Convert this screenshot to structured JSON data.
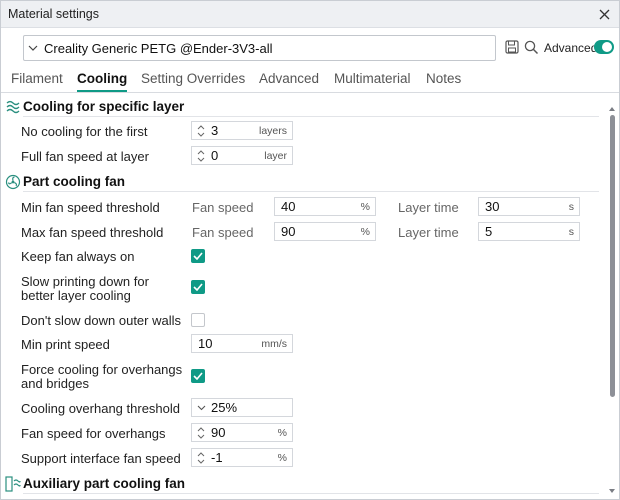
{
  "window": {
    "title": "Material settings"
  },
  "toolbar": {
    "preset": "Creality Generic PETG @Ender-3V3-all",
    "advanced_label": "Advanced",
    "advanced_on": true
  },
  "tabs": [
    {
      "label": "Filament",
      "active": false
    },
    {
      "label": "Cooling",
      "active": true
    },
    {
      "label": "Setting Overrides",
      "active": false
    },
    {
      "label": "Advanced",
      "active": false
    },
    {
      "label": "Multimaterial",
      "active": false
    },
    {
      "label": "Notes",
      "active": false
    }
  ],
  "sections": {
    "cooling_layer": {
      "title": "Cooling for specific layer",
      "rows": [
        {
          "label": "No cooling for the first",
          "value": "3",
          "unit": "layers"
        },
        {
          "label": "Full fan speed at layer",
          "value": "0",
          "unit": "layer"
        }
      ]
    },
    "part_cooling": {
      "title": "Part cooling fan",
      "min_fan": {
        "label": "Min fan speed threshold",
        "fan_label": "Fan speed",
        "fan_value": "40",
        "fan_unit": "%",
        "time_label": "Layer time",
        "time_value": "30",
        "time_unit": "s"
      },
      "max_fan": {
        "label": "Max fan speed threshold",
        "fan_label": "Fan speed",
        "fan_value": "90",
        "fan_unit": "%",
        "time_label": "Layer time",
        "time_value": "5",
        "time_unit": "s"
      },
      "keep_fan": {
        "label": "Keep fan always on",
        "checked": true
      },
      "slow_down": {
        "label_line1": "Slow printing down for",
        "label_line2": "better layer cooling",
        "checked": true
      },
      "dont_slow": {
        "label": "Don't slow down outer walls",
        "checked": false
      },
      "min_speed": {
        "label": "Min print speed",
        "value": "10",
        "unit": "mm/s"
      },
      "force_cooling": {
        "label_line1": "Force cooling for overhangs",
        "label_line2": "and bridges",
        "checked": true
      },
      "overhang_threshold": {
        "label": "Cooling overhang threshold",
        "value": "25%"
      },
      "overhang_fan": {
        "label": "Fan speed for overhangs",
        "value": "90",
        "unit": "%"
      },
      "support_fan": {
        "label": "Support interface fan speed",
        "value": "-1",
        "unit": "%"
      }
    },
    "aux_cooling": {
      "title": "Auxiliary part cooling fan"
    }
  },
  "icons": {
    "close": "close-icon",
    "save": "save-icon",
    "search": "search-icon",
    "chevron": "chevron-down-icon",
    "spinner": "spinner-arrows-icon",
    "section": "fan-icon"
  },
  "colors": {
    "accent": "#0f9a86"
  }
}
